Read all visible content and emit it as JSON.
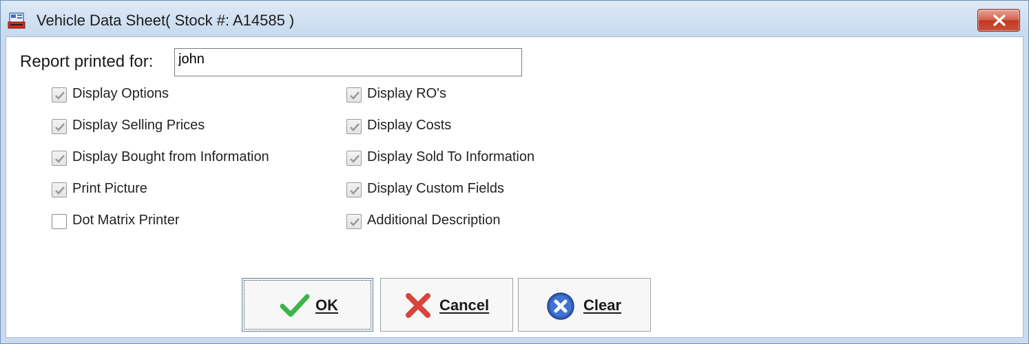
{
  "window": {
    "title": "Vehicle Data Sheet( Stock #: A14585 )",
    "close_label": "Close"
  },
  "report": {
    "label": "Report printed for:",
    "value": "john"
  },
  "options_left": [
    {
      "label": "Display Options",
      "checked": true
    },
    {
      "label": "Display Selling Prices",
      "checked": true
    },
    {
      "label": "Display Bought from Information",
      "checked": true
    },
    {
      "label": "Print Picture",
      "checked": true
    },
    {
      "label": "Dot Matrix Printer",
      "checked": false
    }
  ],
  "options_right": [
    {
      "label": "Display RO's",
      "checked": true
    },
    {
      "label": "Display Costs",
      "checked": true
    },
    {
      "label": "Display Sold To Information",
      "checked": true
    },
    {
      "label": "Display Custom Fields",
      "checked": true
    },
    {
      "label": "Additional Description",
      "checked": true
    }
  ],
  "buttons": {
    "ok": "OK",
    "cancel": "Cancel",
    "clear": "Clear"
  },
  "colors": {
    "ok_icon": "#3cb44a",
    "cancel_icon": "#d9443a",
    "clear_icon": "#2f5fb8",
    "titlebar": "#c9dcef"
  }
}
